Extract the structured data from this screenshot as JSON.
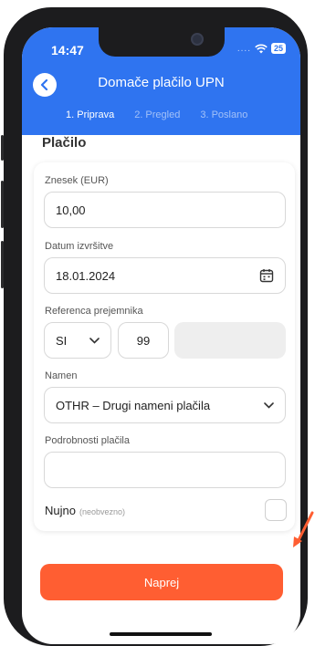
{
  "status": {
    "time": "14:47",
    "battery": "25"
  },
  "header": {
    "title": "Domače plačilo UPN",
    "back_icon": "chevron-left-icon"
  },
  "steps": [
    {
      "label": "1. Priprava",
      "active": true
    },
    {
      "label": "2. Pregled",
      "active": false
    },
    {
      "label": "3. Poslano",
      "active": false
    }
  ],
  "section": {
    "title": "Plačilo"
  },
  "form": {
    "amount": {
      "label": "Znesek (EUR)",
      "value": "10,00"
    },
    "date": {
      "label": "Datum izvršitve",
      "value": "18.01.2024",
      "icon": "calendar-icon"
    },
    "reference": {
      "label": "Referenca prejemnika",
      "prefix": "SI",
      "model": "99",
      "number": ""
    },
    "purpose": {
      "label": "Namen",
      "value": "OTHR – Drugi nameni plačila"
    },
    "details": {
      "label": "Podrobnosti plačila",
      "value": ""
    },
    "urgent": {
      "label": "Nujno",
      "hint": "(neobvezno)",
      "checked": false
    }
  },
  "actions": {
    "next_label": "Naprej"
  },
  "colors": {
    "primary": "#2f74f0",
    "accent": "#ff5e32"
  }
}
